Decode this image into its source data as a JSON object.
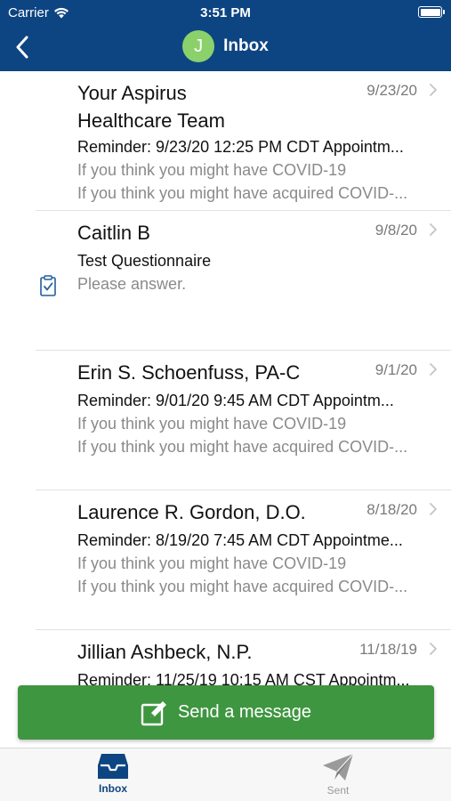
{
  "status": {
    "carrier": "Carrier",
    "time": "3:51 PM"
  },
  "nav": {
    "avatar_letter": "J",
    "title": "Inbox"
  },
  "messages": [
    {
      "sender_line1": "Your Aspirus",
      "sender_line2": "Healthcare Team",
      "date": "9/23/20",
      "subject": "Reminder: 9/23/20 12:25 PM CDT Appointm...",
      "preview1": "If you think you might have COVID-19",
      "preview2": "If you think you might have acquired COVID-..."
    },
    {
      "sender": "Caitlin B",
      "date": "9/8/20",
      "subject": "Test Questionnaire",
      "preview1": "Please answer.",
      "icon": "questionnaire-clipboard-icon"
    },
    {
      "sender": "Erin S. Schoenfuss, PA-C",
      "date": "9/1/20",
      "subject": "Reminder: 9/01/20  9:45 AM CDT Appointm...",
      "preview1": "If you think you might have COVID-19",
      "preview2": "If you think you might have acquired COVID-..."
    },
    {
      "sender": "Laurence R. Gordon, D.O.",
      "date": "8/18/20",
      "subject": "Reminder: 8/19/20  7:45 AM CDT Appointme...",
      "preview1": "If you think you might have COVID-19",
      "preview2": "If you think you might have acquired COVID-..."
    },
    {
      "sender": "Jillian Ashbeck, N.P.",
      "date": "11/18/19",
      "subject": "Reminder: 11/25/19 10:15 AM CST Appointm..."
    }
  ],
  "send_button": {
    "label": "Send a message",
    "icon": "compose-icon"
  },
  "tabs": [
    {
      "label": "Inbox",
      "icon": "inbox-tray-icon",
      "active": true
    },
    {
      "label": "Sent",
      "icon": "paper-plane-icon",
      "active": false
    }
  ],
  "colors": {
    "header_bg": "#0d4582",
    "avatar_bg": "#8bd16b",
    "send_button_bg": "#3e9640",
    "active_tab": "#0d4582",
    "inactive_tab": "#9a9a9a",
    "secondary_text": "#8a8a8a"
  }
}
